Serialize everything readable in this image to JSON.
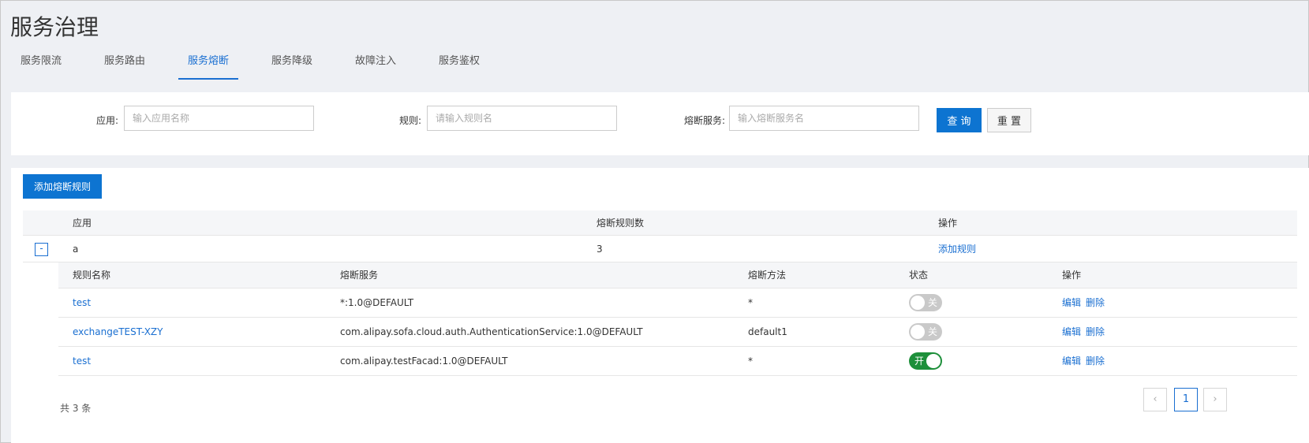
{
  "page": {
    "title": "服务治理"
  },
  "tabs": [
    {
      "label": "服务限流",
      "active": false
    },
    {
      "label": "服务路由",
      "active": false
    },
    {
      "label": "服务熔断",
      "active": true
    },
    {
      "label": "服务降级",
      "active": false
    },
    {
      "label": "故障注入",
      "active": false
    },
    {
      "label": "服务鉴权",
      "active": false
    }
  ],
  "search": {
    "app_label": "应用:",
    "app_placeholder": "输入应用名称",
    "rule_label": "规则:",
    "rule_placeholder": "请输入规则名",
    "service_label": "熔断服务:",
    "service_placeholder": "输入熔断服务名",
    "query_button": "查 询",
    "reset_button": "重 置"
  },
  "toolbar": {
    "add_label": "添加熔断规则"
  },
  "table": {
    "headers": {
      "app": "应用",
      "rule_count": "熔断规则数",
      "actions": "操作"
    },
    "row": {
      "expand_symbol": "-",
      "app": "a",
      "rule_count": "3",
      "action": "添加规则"
    },
    "sub_headers": {
      "name": "规则名称",
      "service": "熔断服务",
      "method": "熔断方法",
      "status": "状态",
      "actions": "操作"
    },
    "sub_rows": [
      {
        "name": "test",
        "service": "*:1.0@DEFAULT",
        "method": "*",
        "status_on": false,
        "status_label": "关",
        "edit": "编辑",
        "delete": "删除"
      },
      {
        "name": "exchangeTEST-XZY",
        "service": "com.alipay.sofa.cloud.auth.AuthenticationService:1.0@DEFAULT",
        "method": "default1",
        "status_on": false,
        "status_label": "关",
        "edit": "编辑",
        "delete": "删除"
      },
      {
        "name": "test",
        "service": "com.alipay.testFacad:1.0@DEFAULT",
        "method": "*",
        "status_on": true,
        "status_label": "开",
        "edit": "编辑",
        "delete": "删除"
      }
    ]
  },
  "pagination": {
    "total": "共 3 条",
    "prev_icon": "‹",
    "current": "1",
    "next_icon": "›"
  },
  "colors": {
    "accent": "#1a6fd1",
    "primary_button": "#0d74d1",
    "toggle_on": "#1d8f3a",
    "toggle_off": "#c9c9c9"
  }
}
